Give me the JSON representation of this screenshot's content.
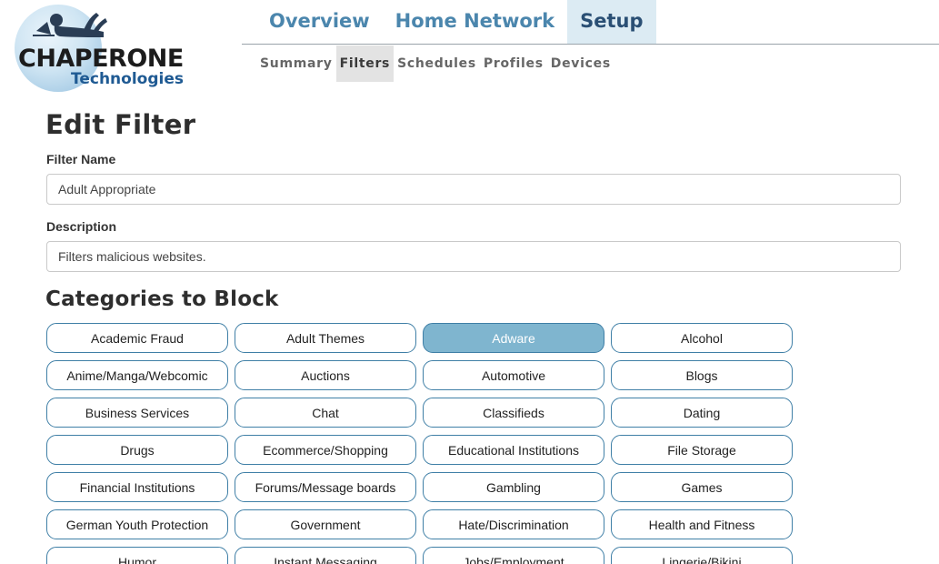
{
  "brand": {
    "name": "CHAPERONE",
    "sub": "Technologies"
  },
  "primary_nav": [
    {
      "label": "Overview",
      "active": false
    },
    {
      "label": "Home Network",
      "active": false
    },
    {
      "label": "Setup",
      "active": true
    }
  ],
  "secondary_nav": [
    {
      "label": "Summary",
      "active": false
    },
    {
      "label": "Filters",
      "active": true
    },
    {
      "label": "Schedules",
      "active": false
    },
    {
      "label": "Profiles",
      "active": false
    },
    {
      "label": "Devices",
      "active": false
    }
  ],
  "page_title": "Edit Filter",
  "form": {
    "name_label": "Filter Name",
    "name_value": "Adult Appropriate",
    "description_label": "Description",
    "description_value": "Filters malicious websites."
  },
  "categories_title": "Categories to Block",
  "categories": [
    {
      "label": "Academic Fraud",
      "selected": false
    },
    {
      "label": "Adult Themes",
      "selected": false
    },
    {
      "label": "Adware",
      "selected": true
    },
    {
      "label": "Alcohol",
      "selected": false
    },
    {
      "label": "Anime/Manga/Webcomic",
      "selected": false
    },
    {
      "label": "Auctions",
      "selected": false
    },
    {
      "label": "Automotive",
      "selected": false
    },
    {
      "label": "Blogs",
      "selected": false
    },
    {
      "label": "Business Services",
      "selected": false
    },
    {
      "label": "Chat",
      "selected": false
    },
    {
      "label": "Classifieds",
      "selected": false
    },
    {
      "label": "Dating",
      "selected": false
    },
    {
      "label": "Drugs",
      "selected": false
    },
    {
      "label": "Ecommerce/Shopping",
      "selected": false
    },
    {
      "label": "Educational Institutions",
      "selected": false
    },
    {
      "label": "File Storage",
      "selected": false
    },
    {
      "label": "Financial Institutions",
      "selected": false
    },
    {
      "label": "Forums/Message boards",
      "selected": false
    },
    {
      "label": "Gambling",
      "selected": false
    },
    {
      "label": "Games",
      "selected": false
    },
    {
      "label": "German Youth Protection",
      "selected": false
    },
    {
      "label": "Government",
      "selected": false
    },
    {
      "label": "Hate/Discrimination",
      "selected": false
    },
    {
      "label": "Health and Fitness",
      "selected": false
    },
    {
      "label": "Humor",
      "selected": false
    },
    {
      "label": "Instant Messaging",
      "selected": false
    },
    {
      "label": "Jobs/Employment",
      "selected": false
    },
    {
      "label": "Lingerie/Bikini",
      "selected": false
    }
  ],
  "colors": {
    "nav_text": "#4b86ad",
    "nav_active_bg": "#dcebf3",
    "category_border": "#3f7fa6",
    "category_selected_bg": "#7fb5cf"
  }
}
